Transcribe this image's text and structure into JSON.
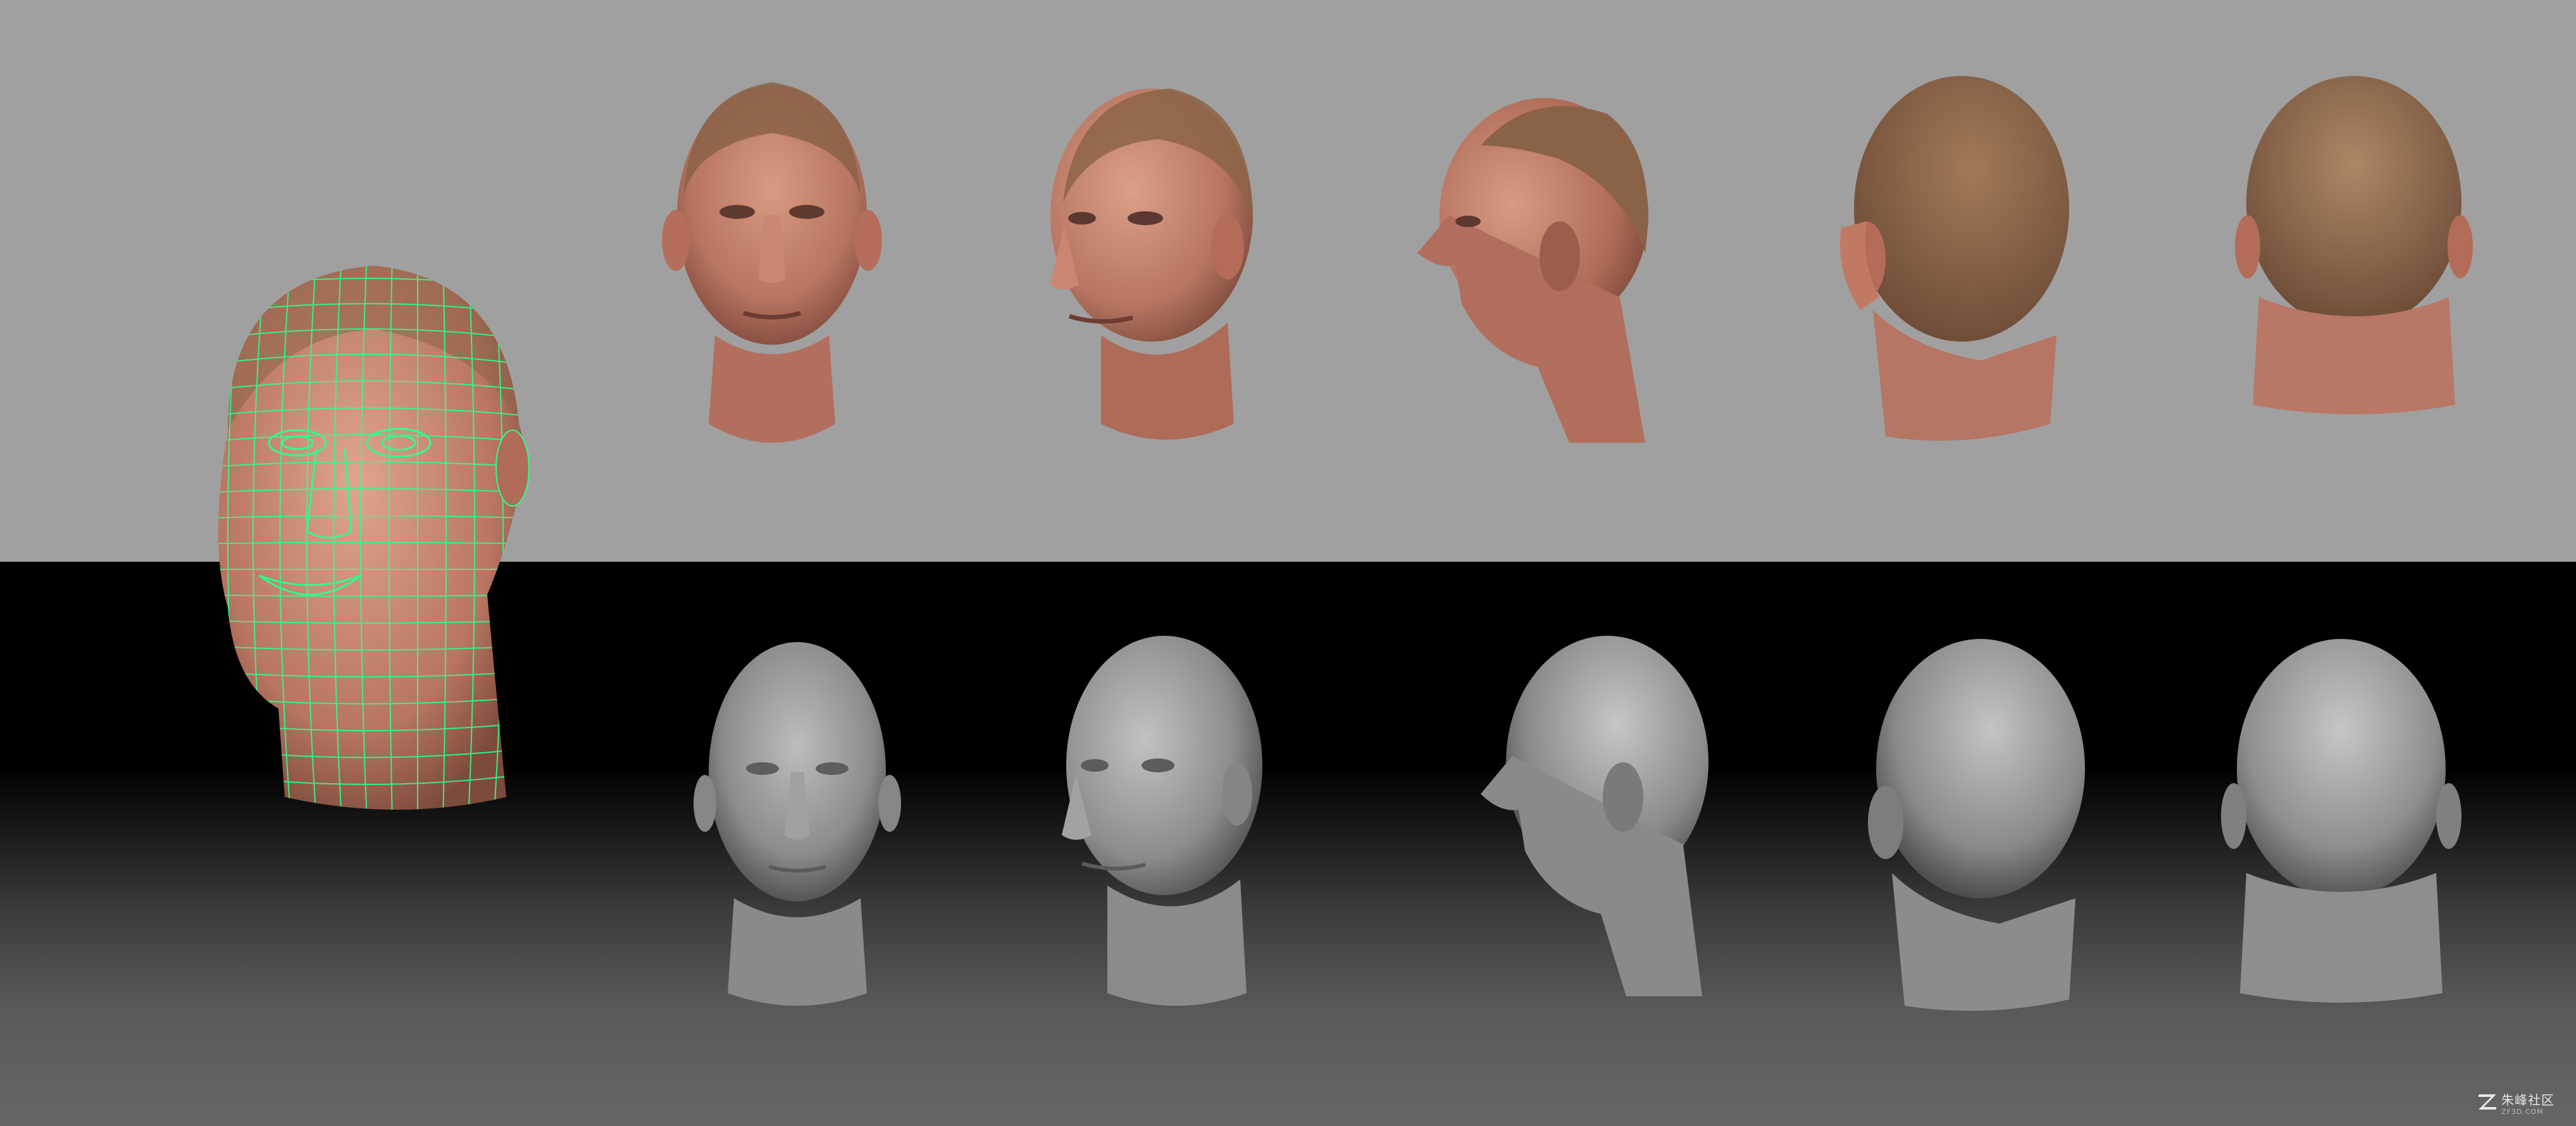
{
  "scene": {
    "description_free": true,
    "colors": {
      "top_background": "#a0a0a0",
      "bottom_background": "#000000",
      "skin": "#c98b72",
      "skin_shadow": "#8e5a4a",
      "hair": "#7a5840",
      "clay": "#8f8f8f",
      "clay_light": "#b3b3b3",
      "wireframe": "#2dff8a"
    }
  },
  "textured_heads": [
    {
      "view": "front"
    },
    {
      "view": "three-quarter-left"
    },
    {
      "view": "profile-left"
    },
    {
      "view": "three-quarter-back"
    },
    {
      "view": "back"
    }
  ],
  "sculpt_heads": [
    {
      "view": "front"
    },
    {
      "view": "three-quarter-left"
    },
    {
      "view": "profile-left"
    },
    {
      "view": "three-quarter-back"
    },
    {
      "view": "back"
    }
  ],
  "wireframe": {
    "view": "three-quarter-front"
  },
  "watermark": {
    "cn_text": "朱峰社区",
    "url_text": "ZF3D.COM"
  }
}
